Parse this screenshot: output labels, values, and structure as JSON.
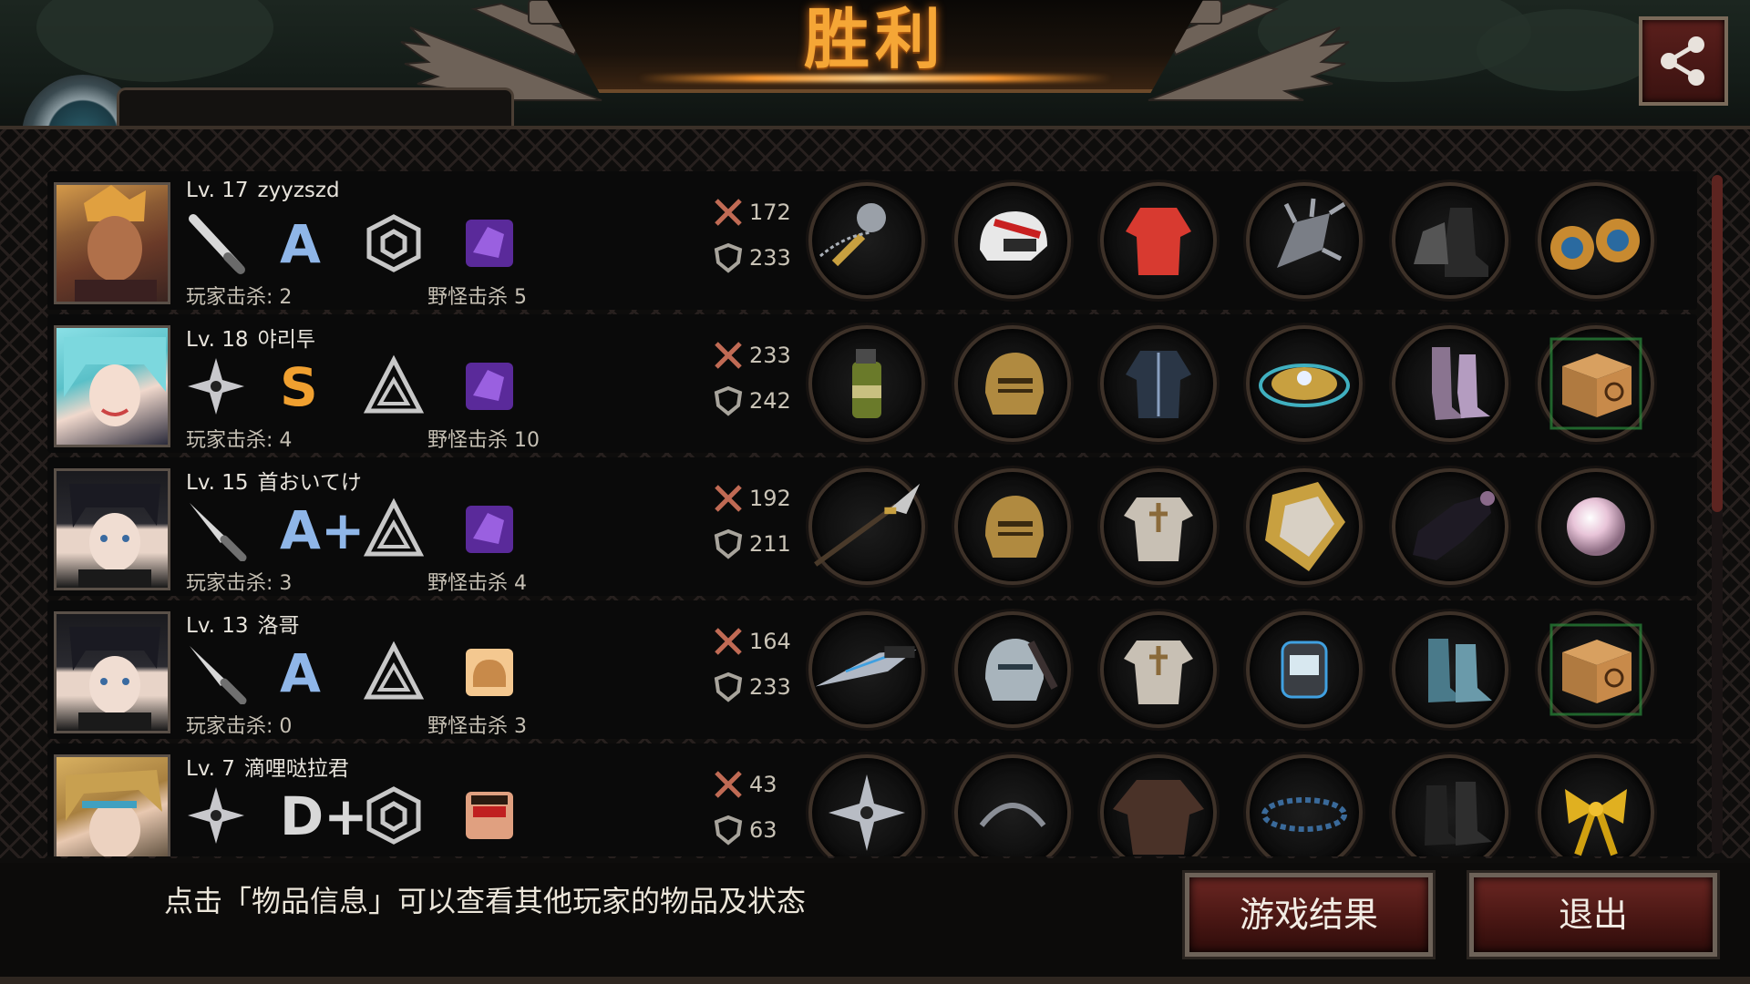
{
  "header": {
    "title": "胜利",
    "share_icon": "share-icon"
  },
  "players": [
    {
      "level": "Lv. 17",
      "name": "zyyzszd",
      "weapon_type": "club",
      "rank": "A",
      "rank_color": "#8fb6e8",
      "drone": "hexagon",
      "buff": "purple",
      "pk_label": "玩家击杀: 2",
      "monster_label": "野怪击杀 5",
      "attack": "172",
      "defense": "233",
      "items": [
        "flail",
        "motocross-helmet",
        "red-jacket",
        "spiked-armguard",
        "combat-boots",
        "blue-earrings"
      ]
    },
    {
      "level": "Lv. 18",
      "name": "야리투",
      "weapon_type": "shuriken",
      "rank": "S",
      "rank_color": "#f0a030",
      "drone": "triangle",
      "buff": "purple",
      "pk_label": "玩家击杀: 4",
      "monster_label": "野怪击杀 10",
      "attack": "233",
      "defense": "242",
      "items": [
        "grenade",
        "knight-helmet",
        "leather-jacket",
        "gold-bracelet",
        "purple-boots",
        "cat-box"
      ]
    },
    {
      "level": "Lv. 15",
      "name": "首おいてけ",
      "weapon_type": "knife",
      "rank": "A+",
      "rank_color": "#8fb6e8",
      "drone": "triangle",
      "buff": "purple",
      "pk_label": "玩家击杀: 3",
      "monster_label": "野怪击杀 4",
      "attack": "192",
      "defense": "211",
      "items": [
        "glaive",
        "knight-helmet",
        "plate-armor",
        "gold-shield",
        "dark-boots",
        "pearl"
      ]
    },
    {
      "level": "Lv. 13",
      "name": "洛哥",
      "weapon_type": "knife",
      "rank": "A",
      "rank_color": "#8fb6e8",
      "drone": "triangle",
      "buff": "bread",
      "pk_label": "玩家击杀: 0",
      "monster_label": "野怪击杀 3",
      "attack": "164",
      "defense": "233",
      "items": [
        "combat-knife",
        "steel-helmet",
        "plate-armor",
        "smart-watch",
        "blue-boots",
        "cat-box"
      ]
    },
    {
      "level": "Lv. 7",
      "name": "滴哩哒拉君",
      "weapon_type": "shuriken",
      "rank": "D+",
      "rank_color": "#d8d8d8",
      "drone": "hexagon",
      "buff": "face",
      "pk_label": "",
      "monster_label": "",
      "attack": "43",
      "defense": "63",
      "items": [
        "shuriken",
        "hairband",
        "brown-jacket",
        "blue-bracelet",
        "black-boots",
        "gold-ribbon"
      ]
    }
  ],
  "footer": {
    "hint": "点击「物品信息」可以查看其他玩家的物品及状态",
    "results_button": "游戏结果",
    "exit_button": "退出"
  },
  "colors": {
    "title": "#f5a636",
    "button_bg": "#4a1714",
    "accent": "#5c2420"
  }
}
